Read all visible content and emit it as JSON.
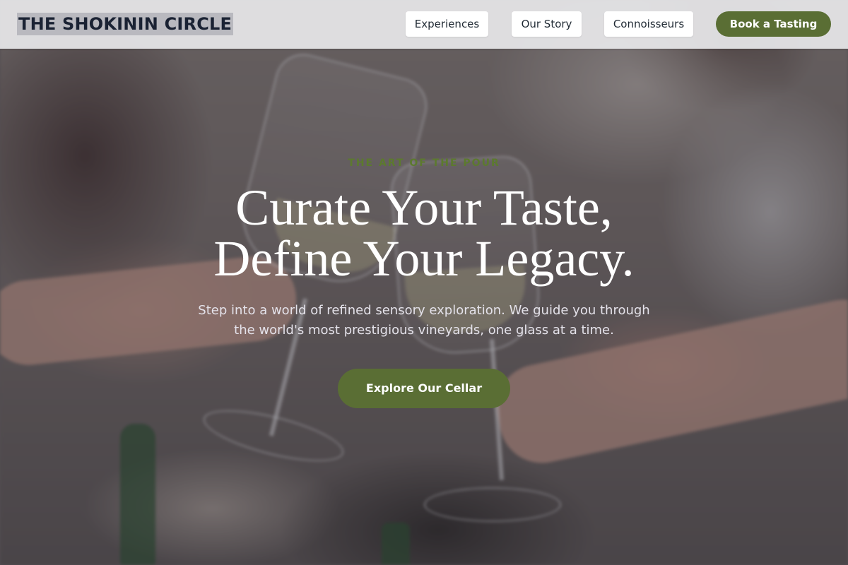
{
  "header": {
    "logo": "THE SHOKININ CIRCLE",
    "nav": [
      {
        "label": "Experiences"
      },
      {
        "label": "Our Story"
      },
      {
        "label": "Connoisseurs"
      }
    ],
    "cta_label": "Book a Tasting"
  },
  "hero": {
    "eyebrow": "THE ART OF THE POUR",
    "headline_line1": "Curate Your Taste,",
    "headline_line2": "Define Your Legacy.",
    "subtitle": "Step into a world of refined sensory exploration. We guide you through the world's most prestigious vineyards, one glass at a time.",
    "cta_label": "Explore Our Cellar"
  },
  "colors": {
    "accent": "#5a6e34",
    "eyebrow": "#5c7a2e",
    "header_bg": "#e8e8ea",
    "logo_text": "#1a2233"
  }
}
